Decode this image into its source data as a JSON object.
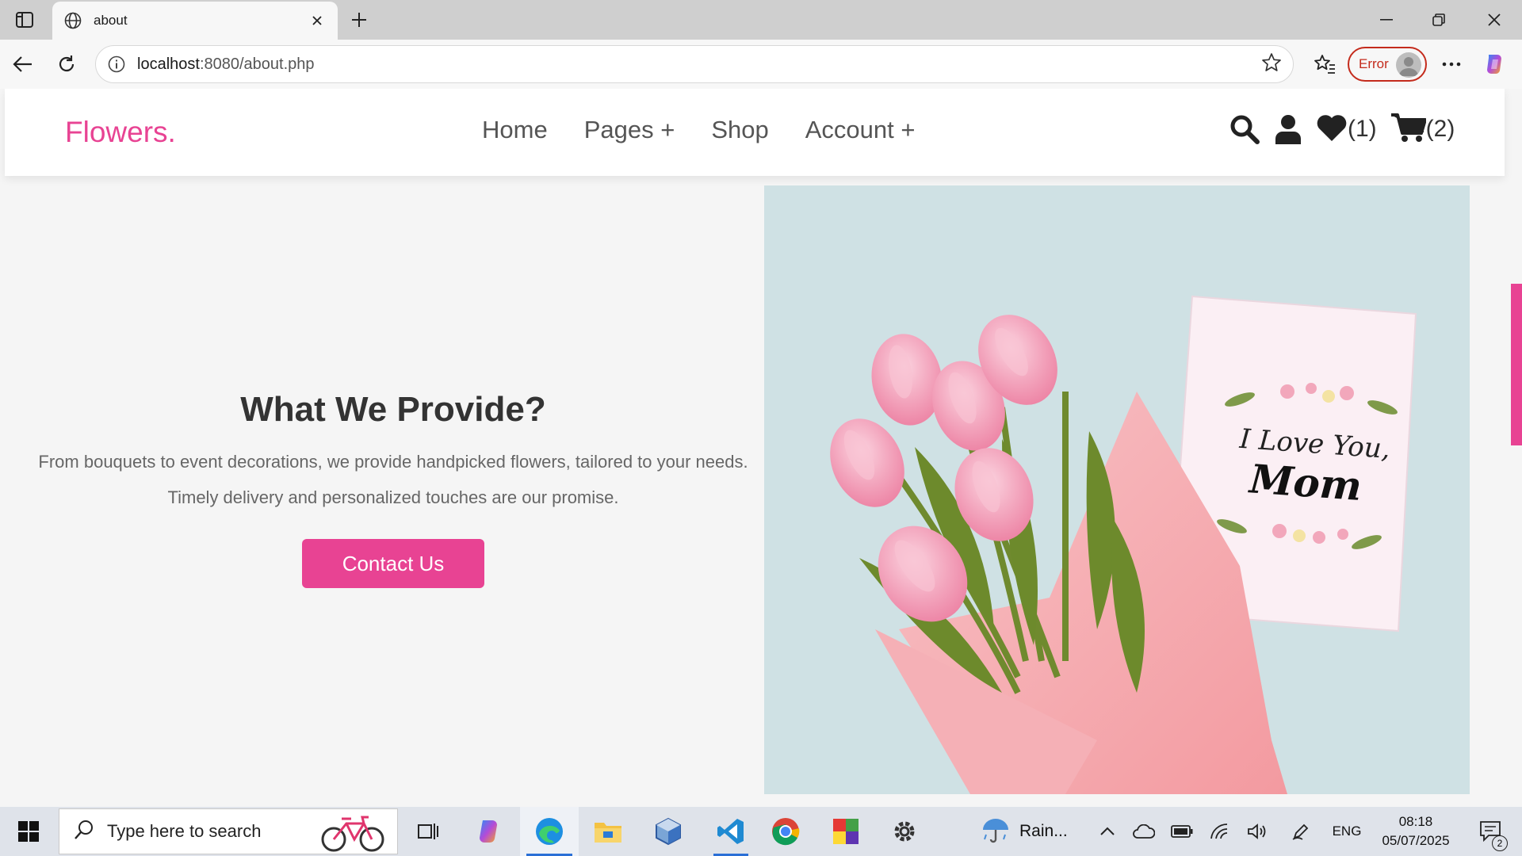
{
  "browser": {
    "tab_title": "about",
    "url_host": "localhost",
    "url_path": ":8080/about.php",
    "error_label": "Error"
  },
  "site": {
    "logo": "Flowers.",
    "nav": [
      "Home",
      "Pages +",
      "Shop",
      "Account +"
    ],
    "wishlist_count": "(1)",
    "cart_count": "(2)",
    "accent_color": "#e84393"
  },
  "about": {
    "title": "What We Provide?",
    "description": "From bouquets to event decorations, we provide handpicked flowers, tailored to your needs. Timely delivery and personalized touches are our promise.",
    "button": "Contact Us",
    "card_line1": "I Love You,",
    "card_line2": "Mom"
  },
  "taskbar": {
    "search_placeholder": "Type here to search",
    "weather": "Rain...",
    "language": "ENG",
    "time": "08:18",
    "date": "05/07/2025",
    "notification_count": "2"
  }
}
